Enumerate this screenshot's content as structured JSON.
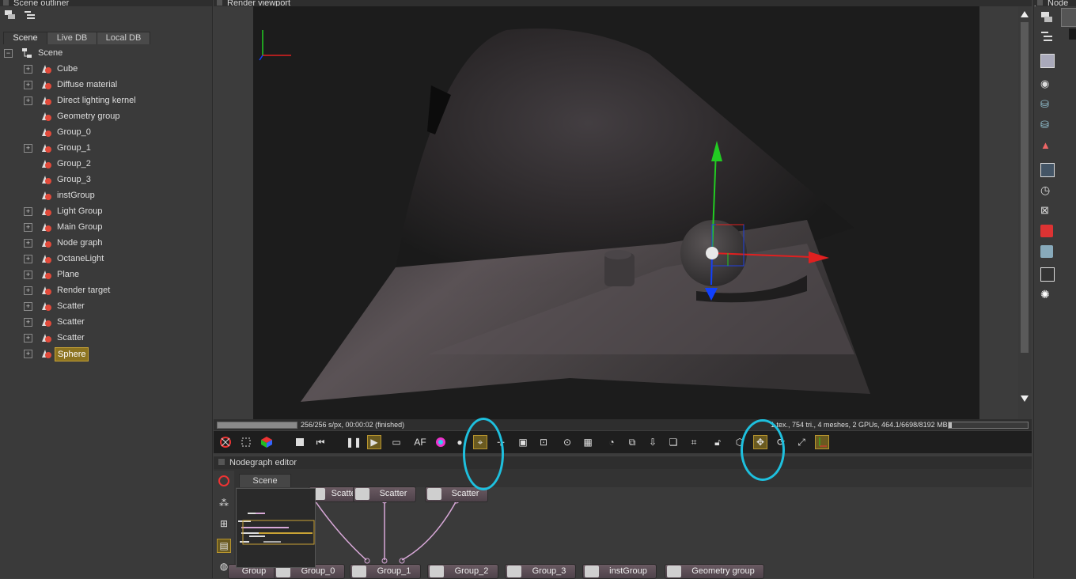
{
  "outliner": {
    "title": "Scene outliner",
    "tabs": [
      "Scene",
      "Live DB",
      "Local DB"
    ],
    "root": "Scene",
    "items": [
      {
        "label": "Cube",
        "expandable": true
      },
      {
        "label": "Diffuse material",
        "expandable": true
      },
      {
        "label": "Direct lighting kernel",
        "expandable": true
      },
      {
        "label": "Geometry group",
        "expandable": false
      },
      {
        "label": "Group_0",
        "expandable": false
      },
      {
        "label": "Group_1",
        "expandable": true
      },
      {
        "label": "Group_2",
        "expandable": false
      },
      {
        "label": "Group_3",
        "expandable": false
      },
      {
        "label": "instGroup",
        "expandable": false
      },
      {
        "label": "Light Group",
        "expandable": true
      },
      {
        "label": "Main Group",
        "expandable": true
      },
      {
        "label": "Node graph",
        "expandable": true
      },
      {
        "label": "OctaneLight",
        "expandable": true
      },
      {
        "label": "Plane",
        "expandable": true
      },
      {
        "label": "Render target",
        "expandable": true
      },
      {
        "label": "Scatter",
        "expandable": true
      },
      {
        "label": "Scatter",
        "expandable": true
      },
      {
        "label": "Scatter",
        "expandable": true
      },
      {
        "label": "Sphere",
        "expandable": true,
        "selected": true
      }
    ]
  },
  "viewport": {
    "title": "Render viewport",
    "status_left": "256/256 s/px, 00:00:02 (finished)",
    "status_right": "1 tex., 754 tri., 4 meshes, 2 GPUs, 464.1/6698/8192 MB"
  },
  "nodegraph": {
    "title": "Nodegraph editor",
    "tab": "Scene",
    "top_nodes": [
      "Scatter",
      "Scatter",
      "Scatter"
    ],
    "bottom_nodes": [
      "Group",
      "Group_0",
      "Group_1",
      "Group_2",
      "Group_3",
      "instGroup",
      "Geometry group"
    ]
  },
  "rightpanel": {
    "title": "Node inspector"
  },
  "colors": {
    "accent": "#b8952e",
    "selection": "#8c7320",
    "annotation": "#1ec0de"
  }
}
